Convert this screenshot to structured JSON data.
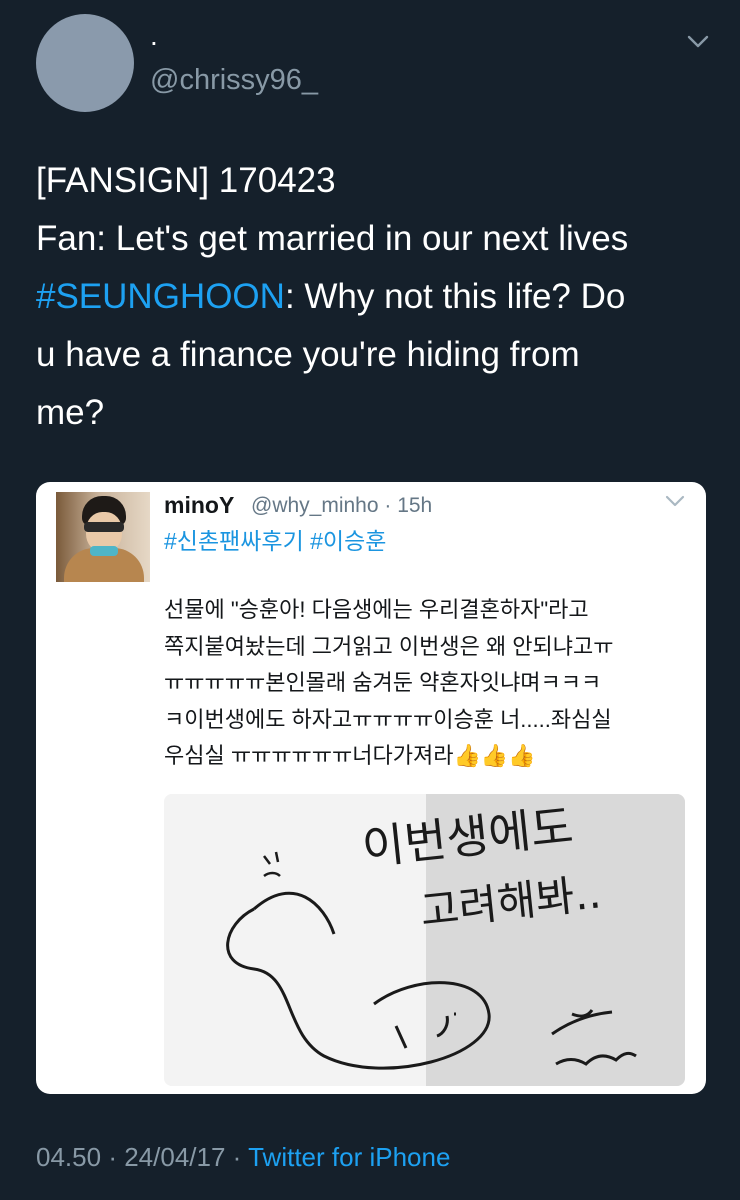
{
  "tweet": {
    "display_name": ".",
    "handle": "@chrissy96_",
    "text_lines": [
      {
        "before": "[FANSIGN] 170423",
        "hashtag": "",
        "after": ""
      },
      {
        "before": "Fan: Let's get married in our next lives",
        "hashtag": "",
        "after": ""
      },
      {
        "before": "",
        "hashtag": "#SEUNGHOON",
        "after": ": Why not this life? Do"
      },
      {
        "before": "u have a finance you're hiding from",
        "hashtag": "",
        "after": ""
      },
      {
        "before": "me?",
        "hashtag": "",
        "after": ""
      }
    ],
    "time": "04.50",
    "date": "24/04/17",
    "separator": "·",
    "source": "Twitter for iPhone"
  },
  "quoted": {
    "name": "minoY",
    "meta": "@why_minho · 15h",
    "hashtags": "#신촌팬싸후기 #이승훈",
    "body_lines": [
      "선물에 \"승훈아! 다음생에는 우리결혼하자\"라고",
      "쪽지붙여놨는데 그거읽고 이번생은 왜 안되냐고ㅠ",
      "ㅠㅠㅠㅠㅠ본인몰래 숨겨둔 약혼자잇냐며ㅋㅋㅋ",
      "ㅋ이번생에도 하자고ㅠㅠㅠㅠ이승훈 너.....좌심실",
      "우심실 ㅠㅠㅠㅠㅠㅠ너다가져라"
    ],
    "thumbs": "👍👍👍",
    "photo_handwriting": [
      "이번생에도",
      "고려해봐.."
    ]
  },
  "icons": {
    "caret": "chevron-down-icon",
    "quoted_caret": "chevron-down-icon"
  },
  "colors": {
    "background": "#15202b",
    "link": "#1da1f2",
    "muted": "#8899a6"
  }
}
